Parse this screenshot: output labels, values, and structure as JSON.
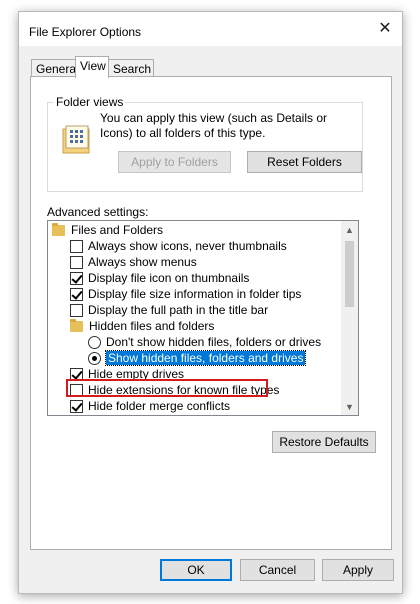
{
  "dialog": {
    "title": "File Explorer Options"
  },
  "tabs": [
    {
      "label": "General",
      "active": false
    },
    {
      "label": "View",
      "active": true
    },
    {
      "label": "Search",
      "active": false
    }
  ],
  "folder_views": {
    "legend": "Folder views",
    "description": "You can apply this view (such as Details or Icons) to all folders of this type.",
    "apply_label": "Apply to Folders",
    "reset_label": "Reset Folders"
  },
  "advanced": {
    "label": "Advanced settings:",
    "items": [
      {
        "type": "folder",
        "label": "Files and Folders"
      },
      {
        "type": "checkbox",
        "checked": false,
        "label": "Always show icons, never thumbnails"
      },
      {
        "type": "checkbox",
        "checked": false,
        "label": "Always show menus"
      },
      {
        "type": "checkbox",
        "checked": true,
        "label": "Display file icon on thumbnails"
      },
      {
        "type": "checkbox",
        "checked": true,
        "label": "Display file size information in folder tips"
      },
      {
        "type": "checkbox",
        "checked": false,
        "label": "Display the full path in the title bar"
      },
      {
        "type": "folder",
        "label": "Hidden files and folders"
      },
      {
        "type": "radio",
        "checked": false,
        "label": "Don't show hidden files, folders or drives"
      },
      {
        "type": "radio",
        "checked": true,
        "label": "Show hidden files, folders and drives"
      },
      {
        "type": "checkbox",
        "checked": true,
        "label": "Hide empty drives"
      },
      {
        "type": "checkbox",
        "checked": false,
        "label": "Hide extensions for known file types"
      },
      {
        "type": "checkbox",
        "checked": true,
        "label": "Hide folder merge conflicts"
      }
    ]
  },
  "buttons": {
    "restore_defaults": "Restore Defaults",
    "ok": "OK",
    "cancel": "Cancel",
    "apply": "Apply"
  },
  "colors": {
    "selection": "#0078d7",
    "highlight_box": "#d41c1c",
    "focus": "#0078d7"
  }
}
